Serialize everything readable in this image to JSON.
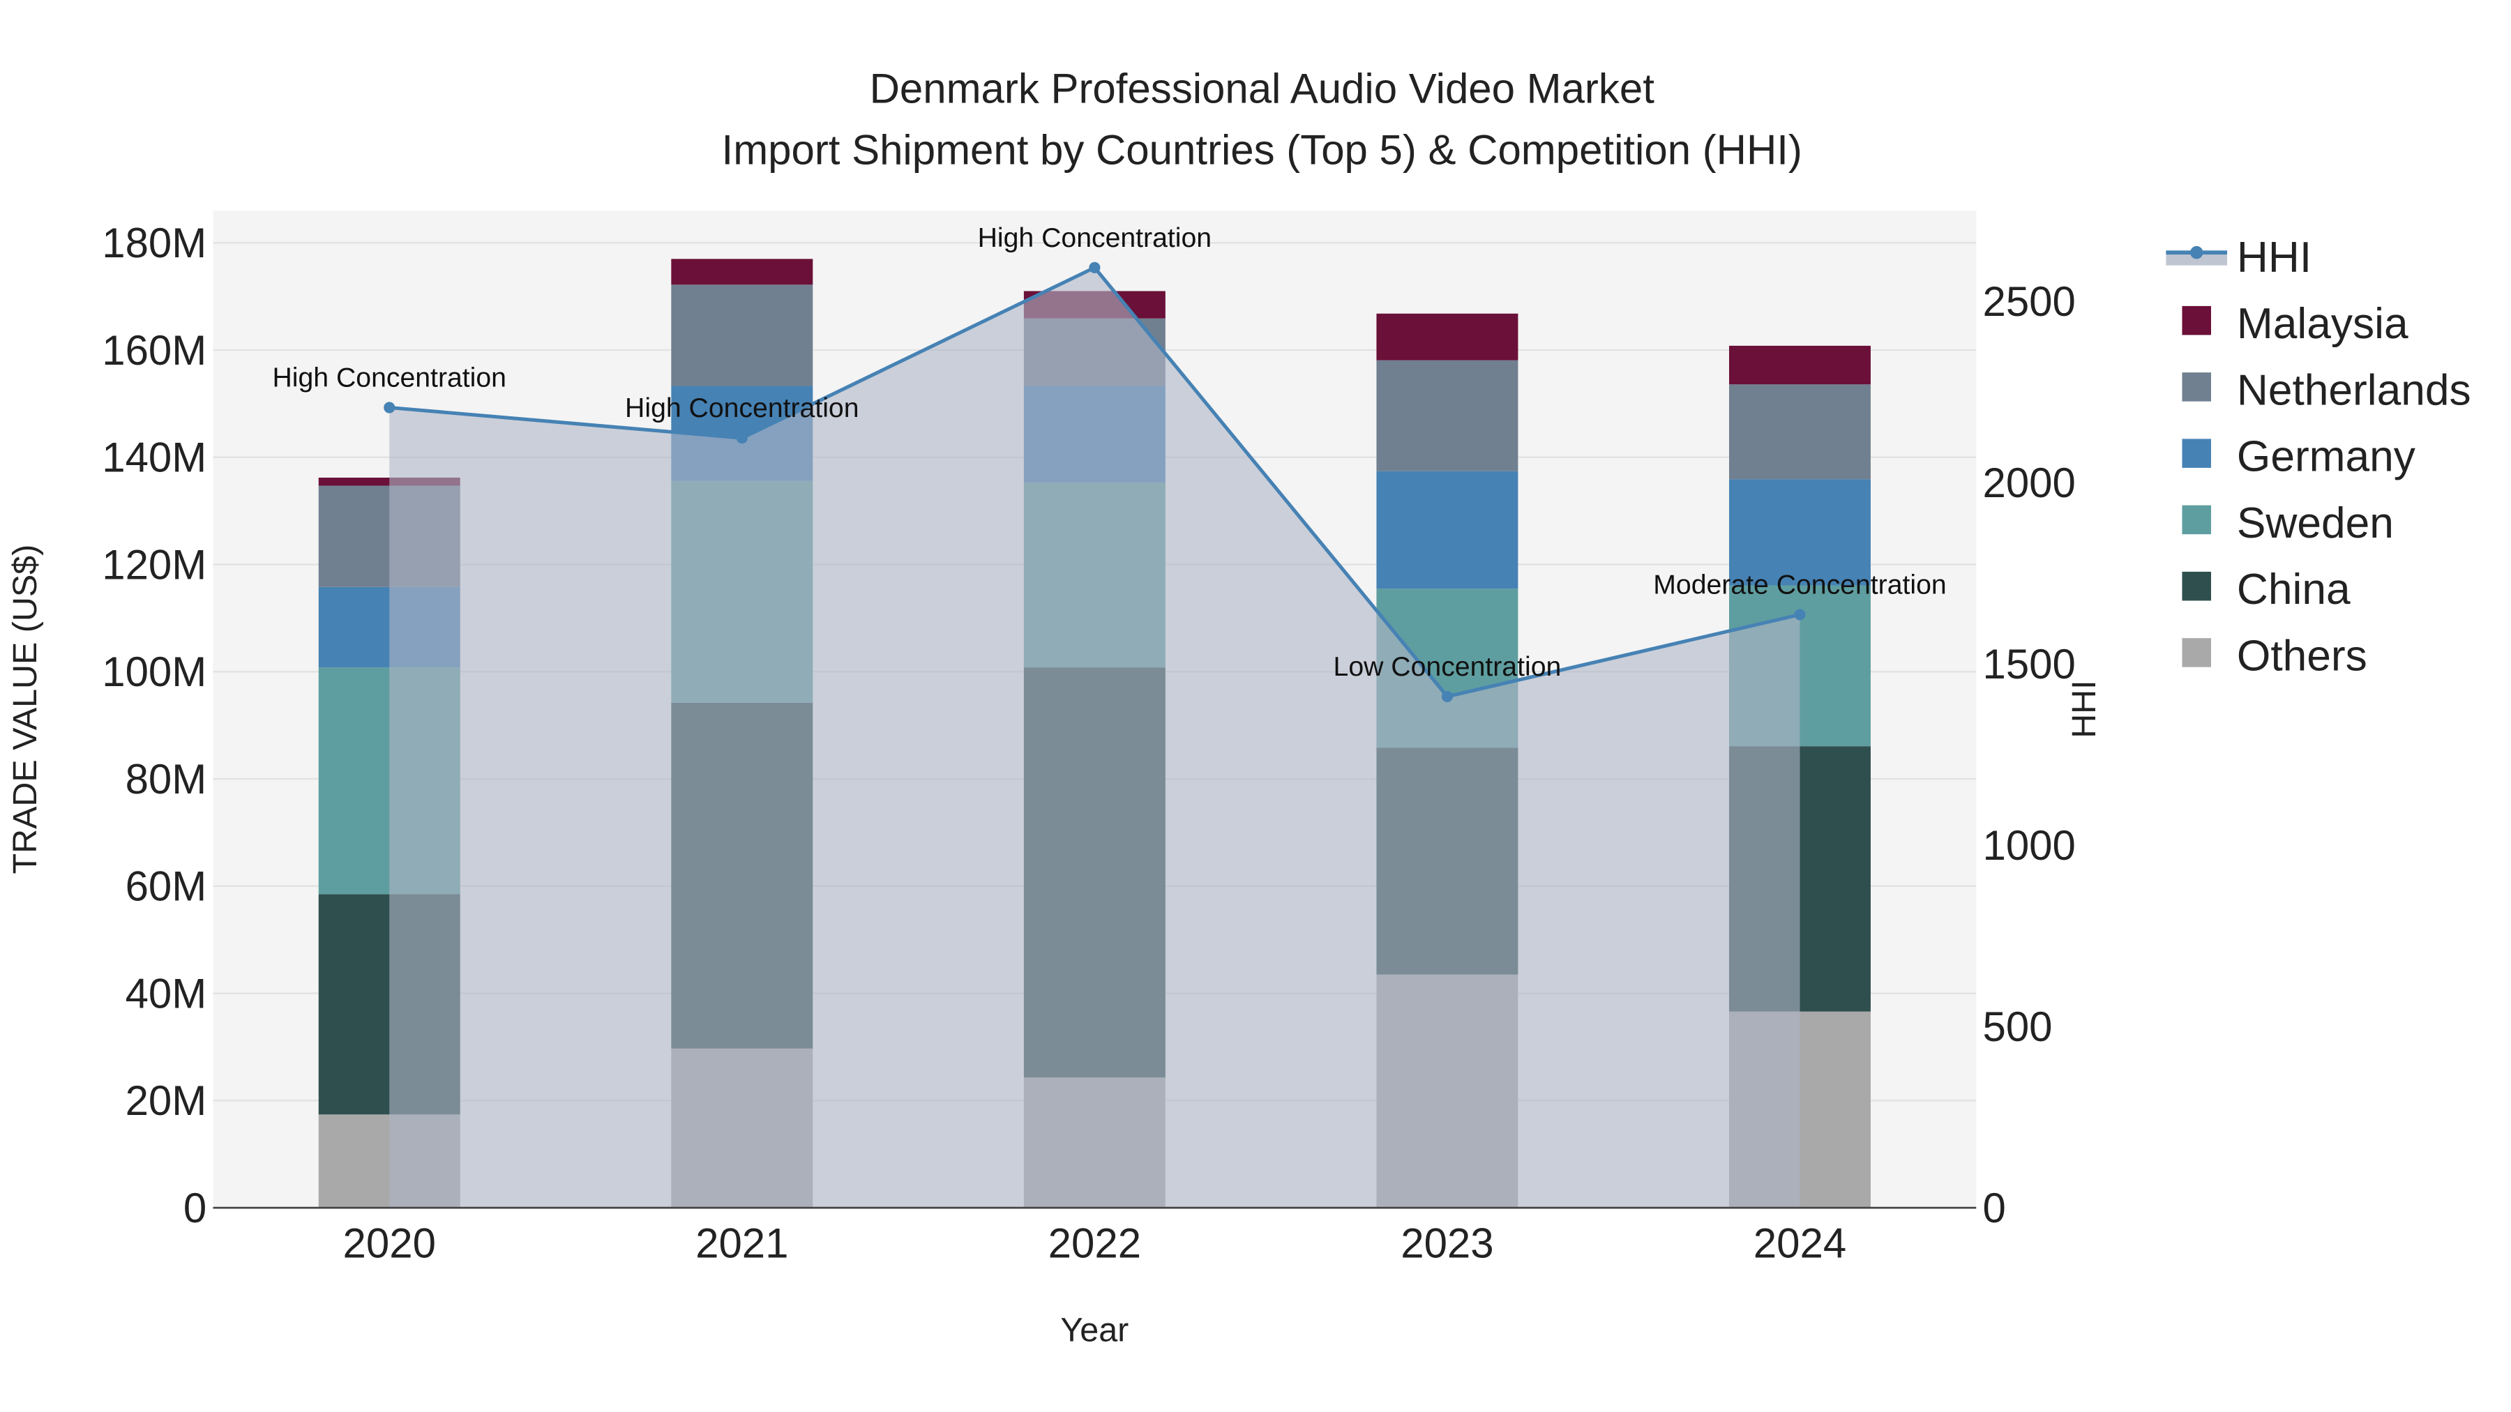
{
  "chart_data": {
    "type": "bar",
    "stacked": true,
    "title": "Denmark Professional Audio Video Market",
    "subtitle": "Import Shipment by Countries (Top 5) & Competition (HHI)",
    "xlabel": "Year",
    "ylabel": "TRADE VALUE (US$)",
    "y2label": "HHI",
    "categories": [
      "2020",
      "2021",
      "2022",
      "2023",
      "2024"
    ],
    "ylim": [
      0,
      186
    ],
    "yticks": [
      0,
      20,
      40,
      60,
      80,
      100,
      120,
      140,
      160,
      180
    ],
    "ytick_labels": [
      "0",
      "20M",
      "40M",
      "60M",
      "80M",
      "100M",
      "120M",
      "140M",
      "160M",
      "180M"
    ],
    "y2lim": [
      0,
      2750
    ],
    "y2ticks": [
      0,
      500,
      1000,
      1500,
      2000,
      2500
    ],
    "y2tick_labels": [
      "0",
      "500",
      "1000",
      "1500",
      "2000",
      "2500"
    ],
    "units": "million US$",
    "series": [
      {
        "name": "Others",
        "color": "#a9a9a9",
        "values": [
          17.4,
          29.7,
          24.3,
          43.5,
          36.6
        ]
      },
      {
        "name": "China",
        "color": "#2f4f4f",
        "values": [
          41.1,
          64.5,
          76.5,
          42.3,
          49.5
        ]
      },
      {
        "name": "Sweden",
        "color": "#5f9ea0",
        "values": [
          42.3,
          41.4,
          34.5,
          29.7,
          30.0
        ]
      },
      {
        "name": "Germany",
        "color": "#4682b4",
        "values": [
          15.0,
          17.7,
          18.0,
          21.9,
          19.8
        ]
      },
      {
        "name": "Netherlands",
        "color": "#708090",
        "values": [
          18.9,
          18.9,
          12.6,
          20.7,
          17.7
        ]
      },
      {
        "name": "Malaysia",
        "color": "#6b1038",
        "values": [
          1.5,
          4.8,
          5.1,
          8.7,
          7.2
        ]
      }
    ],
    "hhi": {
      "name": "HHI",
      "color": "#4682b4",
      "values": [
        2207,
        2123,
        2593,
        1410,
        1636
      ],
      "annotations": [
        "High Concentration",
        "High Concentration",
        "High Concentration",
        "Low Concentration",
        "Moderate Concentration"
      ]
    },
    "legend": {
      "placement": "right",
      "items": [
        "HHI",
        "Malaysia",
        "Netherlands",
        "Germany",
        "Sweden",
        "China",
        "Others"
      ]
    },
    "grid": true
  }
}
